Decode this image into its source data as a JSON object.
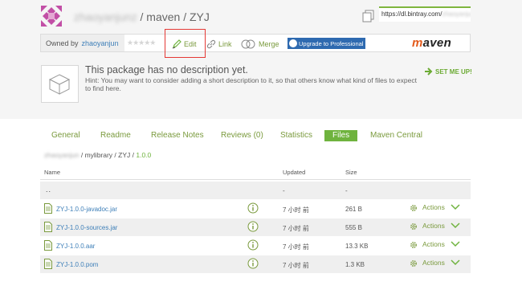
{
  "header": {
    "owner_blurred": "zhaoyanjunz",
    "crumb_path": "/ maven / ZYJ",
    "url_visible": "https://dl.bintray.com/",
    "url_blurred": "zhaoyanjun"
  },
  "toolbar": {
    "owned_by_label": "Owned by",
    "owner": "zhaoyanjun",
    "stars": "★★★★★",
    "edit_label": "Edit",
    "link_label": "Link",
    "merge_label": "Merge",
    "upgrade_label": "Upgrade to Professional",
    "maven_logo_prefix": "m",
    "maven_logo_rest": "aven"
  },
  "description": {
    "title": "This package has no description yet.",
    "hint": "Hint: You may want to consider adding a short description to it, so that others know what kind of files to expect to find here.",
    "set_me_up": "SET ME UP!"
  },
  "tabs": [
    {
      "label": "General"
    },
    {
      "label": "Readme"
    },
    {
      "label": "Release Notes"
    },
    {
      "label": "Reviews (0)"
    },
    {
      "label": "Statistics"
    },
    {
      "label": "Files",
      "active": true
    },
    {
      "label": "Maven Central"
    }
  ],
  "path": {
    "blurred": "zhaoyanjun",
    "middle": "/ mylibrary / ZYJ /",
    "current": "1.0.0"
  },
  "table": {
    "headers": {
      "name": "Name",
      "updated": "Updated",
      "size": "Size"
    },
    "parent_row": {
      "name": "..",
      "updated": "-",
      "size": "-"
    },
    "rows": [
      {
        "name": "ZYJ-1.0.0-javadoc.jar",
        "updated": "7 小时 前",
        "size": "261 B",
        "actions": "Actions"
      },
      {
        "name": "ZYJ-1.0.0-sources.jar",
        "updated": "7 小时 前",
        "size": "555 B",
        "actions": "Actions"
      },
      {
        "name": "ZYJ-1.0.0.aar",
        "updated": "7 小时 前",
        "size": "13.3 KB",
        "actions": "Actions"
      },
      {
        "name": "ZYJ-1.0.0.pom",
        "updated": "7 小时 前",
        "size": "1.3 KB",
        "actions": "Actions"
      }
    ]
  },
  "colors": {
    "accent_green": "#6fb33e",
    "link_blue": "#3e7fb8",
    "highlight_red": "#e53935",
    "upgrade_blue": "#2e6ab0"
  },
  "icons": [
    "avatar-identicon",
    "copy-icon",
    "edit-pencil-icon",
    "link-icon",
    "merge-icon",
    "upgrade-icon",
    "package-box-icon",
    "set-me-up-arrow-icon",
    "file-icon",
    "info-icon",
    "gear-icon",
    "chevron-down-icon"
  ]
}
